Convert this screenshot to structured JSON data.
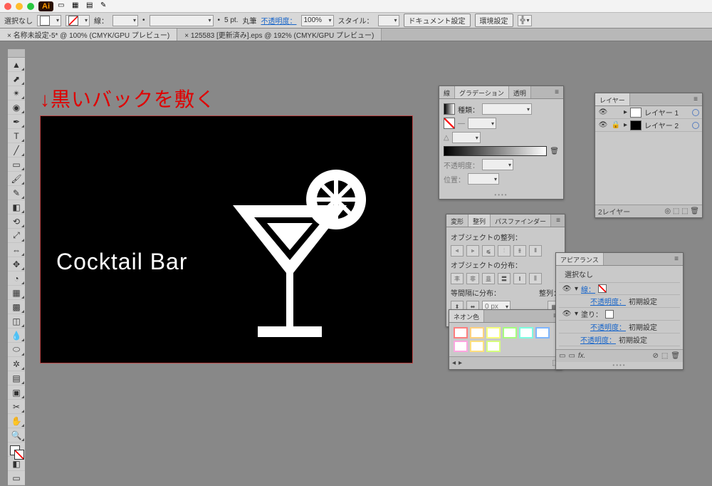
{
  "os": {
    "app_badge": "Ai"
  },
  "ctrlbar": {
    "selection": "選択なし",
    "stroke_label": "線：",
    "weight": "5 pt.",
    "brush": "丸筆",
    "opacity_label": "不透明度：",
    "opacity_value": "100%",
    "style_label": "スタイル：",
    "doc_setup": "ドキュメント設定",
    "env_setup": "環境設定"
  },
  "tabs": [
    {
      "label": "× 名称未設定-5* @ 100% (CMYK/GPU プレビュー)",
      "active": true
    },
    {
      "label": "× 125583 [更新済み].eps @ 192% (CMYK/GPU プレビュー)",
      "active": false
    }
  ],
  "annotation": "↓黒いバックを敷く",
  "artwork_text": "Cocktail Bar",
  "gradient_panel": {
    "tabs": [
      "線",
      "グラデーション",
      "透明"
    ],
    "type_label": "種類：",
    "angle_label": "△",
    "opacity_label": "不透明度：",
    "pos_label": "位置："
  },
  "layers_panel": {
    "tab": "レイヤー",
    "rows": [
      {
        "name": "レイヤー 1",
        "thumb": "white"
      },
      {
        "name": "レイヤー 2",
        "thumb": "black",
        "locked": true
      }
    ],
    "footer": "2レイヤー"
  },
  "align_panel": {
    "tabs": [
      "変形",
      "整列",
      "パスファインダー"
    ],
    "sect1": "オブジェクトの整列：",
    "sect2": "オブジェクトの分布：",
    "sect3": "等間隔に分布：",
    "right_label": "整列："
  },
  "swatches_panel": {
    "tab": "ネオン色",
    "colors": [
      "#ff7e7e",
      "#ffd27e",
      "#f6ff7e",
      "#a6ff7e",
      "#7effe0",
      "#7eb6ff",
      "#ffa6e0",
      "#ffe07e",
      "#d6ff7e"
    ]
  },
  "appearance_panel": {
    "tab": "アピアランス",
    "no_selection": "選択なし",
    "stroke": "線：",
    "fill": "塗り：",
    "opacity": "不透明度：",
    "default": "初期設定"
  }
}
